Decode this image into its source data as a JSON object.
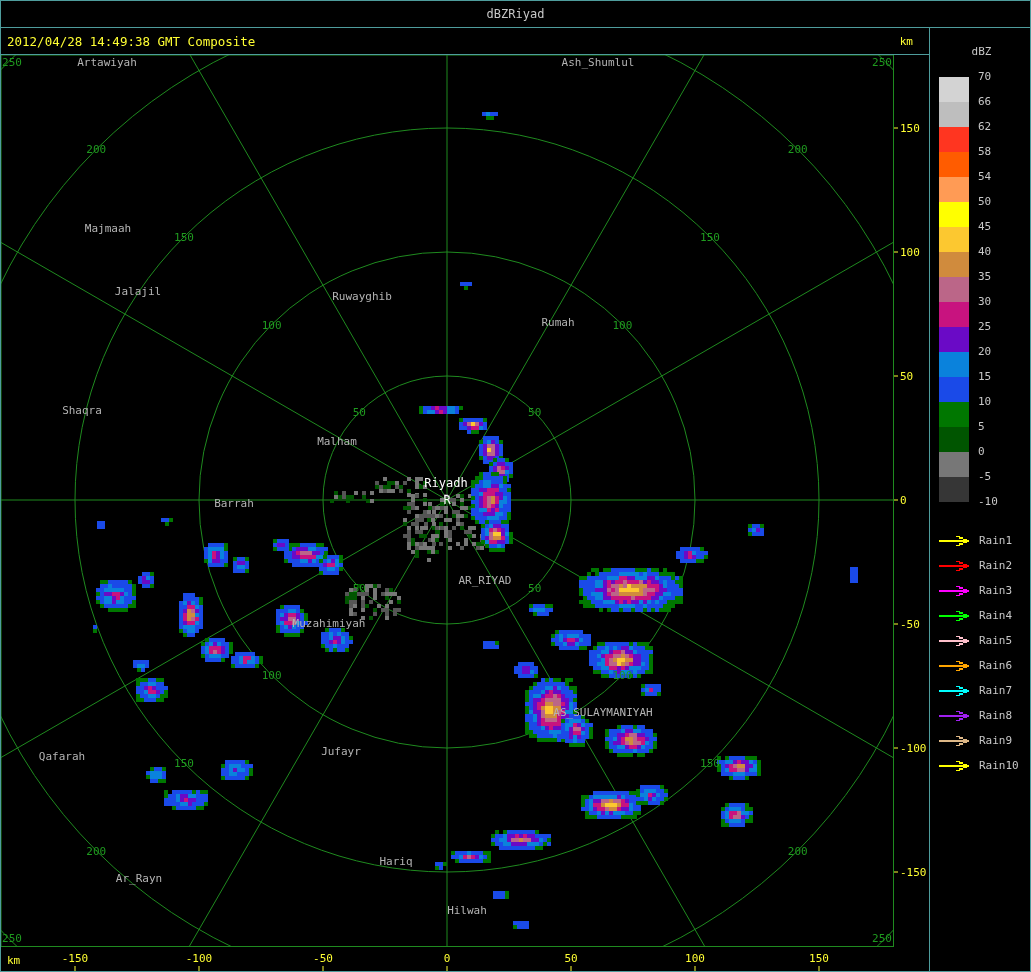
{
  "window": {
    "title": "dBZRiyad"
  },
  "header": {
    "timestamp": "2012/04/28 14:49:38 GMT Composite",
    "unit": "km"
  },
  "map": {
    "rings": [
      {
        "labels": [
          "50",
          "50",
          "50",
          "50"
        ]
      },
      {
        "labels": [
          "100",
          "100",
          "100",
          "100"
        ]
      },
      {
        "labels": [
          "150",
          "150",
          "150",
          "150"
        ]
      },
      {
        "labels": [
          "200",
          "200",
          "200",
          "200"
        ]
      },
      {
        "labels": [
          "250",
          "250",
          "250",
          "250"
        ]
      }
    ],
    "places": [
      {
        "name": "Artawiyah",
        "kind": "town"
      },
      {
        "name": "Ash_Shumlul",
        "kind": "town"
      },
      {
        "name": "Majmaah",
        "kind": "town"
      },
      {
        "name": "Jalajil",
        "kind": "town"
      },
      {
        "name": "Ruwayghib",
        "kind": "town"
      },
      {
        "name": "Rumah",
        "kind": "town"
      },
      {
        "name": "Shaqra",
        "kind": "town"
      },
      {
        "name": "Malham",
        "kind": "town"
      },
      {
        "name": "Riyadh",
        "kind": "site"
      },
      {
        "name": "R",
        "kind": "site"
      },
      {
        "name": "Barrah",
        "kind": "town"
      },
      {
        "name": "AR_RIYAD",
        "kind": "town"
      },
      {
        "name": "Muzahimiyah",
        "kind": "town"
      },
      {
        "name": "AS_SULAYMANIYAH",
        "kind": "town"
      },
      {
        "name": "Qafarah",
        "kind": "town"
      },
      {
        "name": "Jufayr",
        "kind": "town"
      },
      {
        "name": "Hariq",
        "kind": "town"
      },
      {
        "name": "Ar_Rayn",
        "kind": "town"
      },
      {
        "name": "Hilwah",
        "kind": "town"
      }
    ]
  },
  "y_axis": {
    "ticks": [
      "150",
      "100",
      "50",
      "0",
      "-50",
      "-100",
      "-150"
    ]
  },
  "x_axis": {
    "unit": "km",
    "ticks": [
      "-150",
      "-100",
      "-50",
      "0",
      "50",
      "100",
      "150"
    ]
  },
  "legend": {
    "title": "dBZ",
    "bands": [
      {
        "color": "#d3d3d3"
      },
      {
        "color": "#bebebe"
      },
      {
        "color": "#ff3520"
      },
      {
        "color": "#ff5c00"
      },
      {
        "color": "#ff9b55"
      },
      {
        "color": "#ffff00"
      },
      {
        "color": "#fcc830"
      },
      {
        "color": "#d08b3d"
      },
      {
        "color": "#bb6688"
      },
      {
        "color": "#c8137f"
      },
      {
        "color": "#6a0ac6"
      },
      {
        "color": "#0a82dc"
      },
      {
        "color": "#1a4ae8"
      },
      {
        "color": "#007700"
      },
      {
        "color": "#005500"
      },
      {
        "color": "#777777"
      },
      {
        "color": "#363636"
      }
    ],
    "scale_labels": [
      "70",
      "66",
      "62",
      "58",
      "54",
      "50",
      "45",
      "40",
      "35",
      "30",
      "25",
      "20",
      "15",
      "10",
      "5",
      "0",
      "-5",
      "-10"
    ],
    "tracks": [
      {
        "label": "Rain1",
        "color": "#ffff00"
      },
      {
        "label": "Rain2",
        "color": "#ff0000"
      },
      {
        "label": "Rain3",
        "color": "#ff00ff"
      },
      {
        "label": "Rain4",
        "color": "#00ff00"
      },
      {
        "label": "Rain5",
        "color": "#ffc0cb"
      },
      {
        "label": "Rain6",
        "color": "#ffa500"
      },
      {
        "label": "Rain7",
        "color": "#00ffff"
      },
      {
        "label": "Rain8",
        "color": "#a020f0"
      },
      {
        "label": "Rain9",
        "color": "#deb887"
      },
      {
        "label": "Rain10",
        "color": "#ffff00"
      }
    ]
  }
}
